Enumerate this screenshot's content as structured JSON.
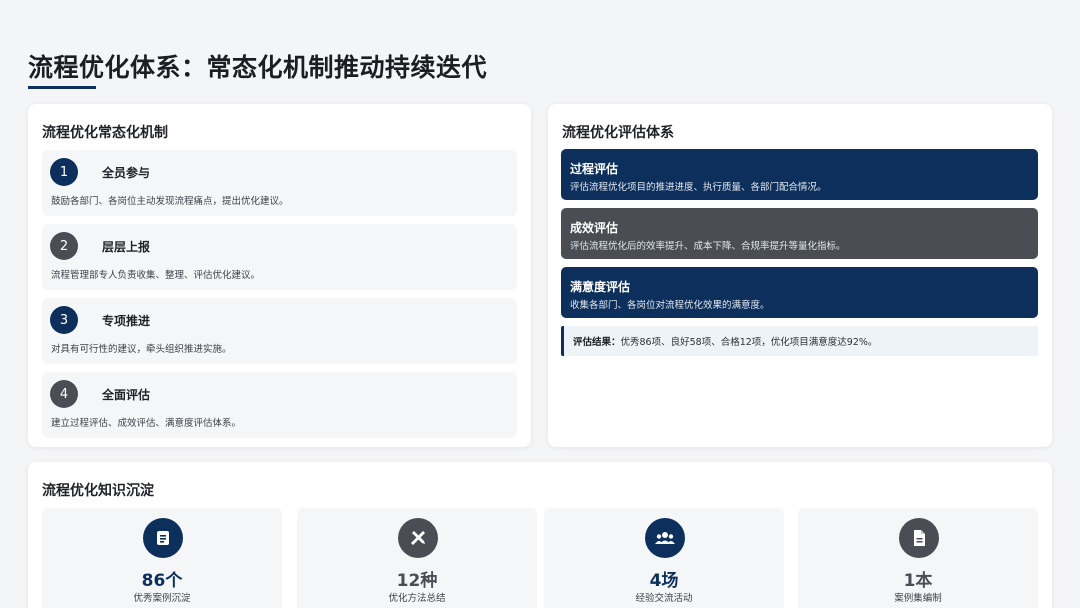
{
  "page": {
    "title": "流程优化体系：常态化机制推动持续迭代"
  },
  "mechanism": {
    "title": "流程优化常态化机制",
    "steps": [
      {
        "num": "1",
        "title": "全员参与",
        "desc": "鼓励各部门、各岗位主动发现流程痛点，提出优化建议。",
        "color": "#0c2f5c"
      },
      {
        "num": "2",
        "title": "层层上报",
        "desc": "流程管理部专人负责收集、整理、评估优化建议。",
        "color": "#4a4e54"
      },
      {
        "num": "3",
        "title": "专项推进",
        "desc": "对具有可行性的建议，牵头组织推进实施。",
        "color": "#0c2f5c"
      },
      {
        "num": "4",
        "title": "全面评估",
        "desc": "建立过程评估、成效评估、满意度评估体系。",
        "color": "#4a4e54"
      }
    ]
  },
  "evaluation": {
    "title": "流程优化评估体系",
    "items": [
      {
        "title": "过程评估",
        "desc": "评估流程优化项目的推进进度、执行质量、各部门配合情况。",
        "color": "#0c2f5c"
      },
      {
        "title": "成效评估",
        "desc": "评估流程优化后的效率提升、成本下降、合规率提升等量化指标。",
        "color": "#4a4e54"
      },
      {
        "title": "满意度评估",
        "desc": "收集各部门、各岗位对流程优化效果的满意度。",
        "color": "#0c2f5c"
      }
    ],
    "result_label": "评估结果：",
    "result_text": "优秀86项、良好58项、合格12项，优化项目满意度达92%。"
  },
  "knowledge": {
    "title": "流程优化知识沉淀",
    "stats": [
      {
        "icon": "document-list-icon",
        "value": "86个",
        "label": "优秀案例沉淀",
        "color": "#0c2f5c"
      },
      {
        "icon": "tools-icon",
        "value": "12种",
        "label": "优化方法总结",
        "color": "#4a4e54"
      },
      {
        "icon": "people-group-icon",
        "value": "4场",
        "label": "经验交流活动",
        "color": "#0c2f5c"
      },
      {
        "icon": "file-icon",
        "value": "1本",
        "label": "案例集编制",
        "color": "#4a4e54"
      }
    ]
  }
}
